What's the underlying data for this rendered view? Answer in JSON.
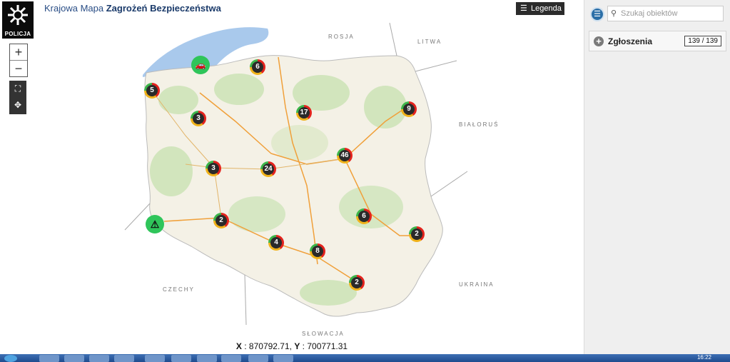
{
  "header": {
    "logo_text": "POLICJA",
    "title_prefix": "Krajowa Mapa ",
    "title_bold": "Zagrożeń Bezpieczeństwa",
    "legend_label": "Legenda"
  },
  "map_controls": {
    "zoom_in": "+",
    "zoom_out": "−"
  },
  "countries": {
    "rosja": "ROSJA",
    "litwa": "LITWA",
    "bialorus": "BIAŁORUŚ",
    "ukraina": "UKRAINA",
    "slowacja": "SŁOWACJA",
    "czechy": "CZECHY"
  },
  "clusters": {
    "gdansk": "6",
    "szczecin": "5",
    "gorzow": "3",
    "bydgoszcz": "17",
    "bialystok": "9",
    "warszawa": "46",
    "zielona_gora": "3",
    "poznan": "24",
    "wroclaw": "2",
    "kielce": "6",
    "lublin": "2",
    "opole": "4",
    "krakow": "8",
    "rzeszow": "2"
  },
  "colors": {
    "accent": "#2a6ea7",
    "cluster_red": "#e3231d",
    "cluster_yellow": "#f0b21a",
    "cluster_green": "#3cb54a",
    "marker_green": "#2fc55a"
  },
  "coordinates": {
    "x_label": "X",
    "x_value": "870792.71",
    "y_label": "Y",
    "y_value": "700771.31"
  },
  "sidebar": {
    "search_placeholder": "Szukaj obiektów",
    "section_label": "Zgłoszenia",
    "count": "139 / 139"
  },
  "taskbar": {
    "clock": "16:22"
  }
}
